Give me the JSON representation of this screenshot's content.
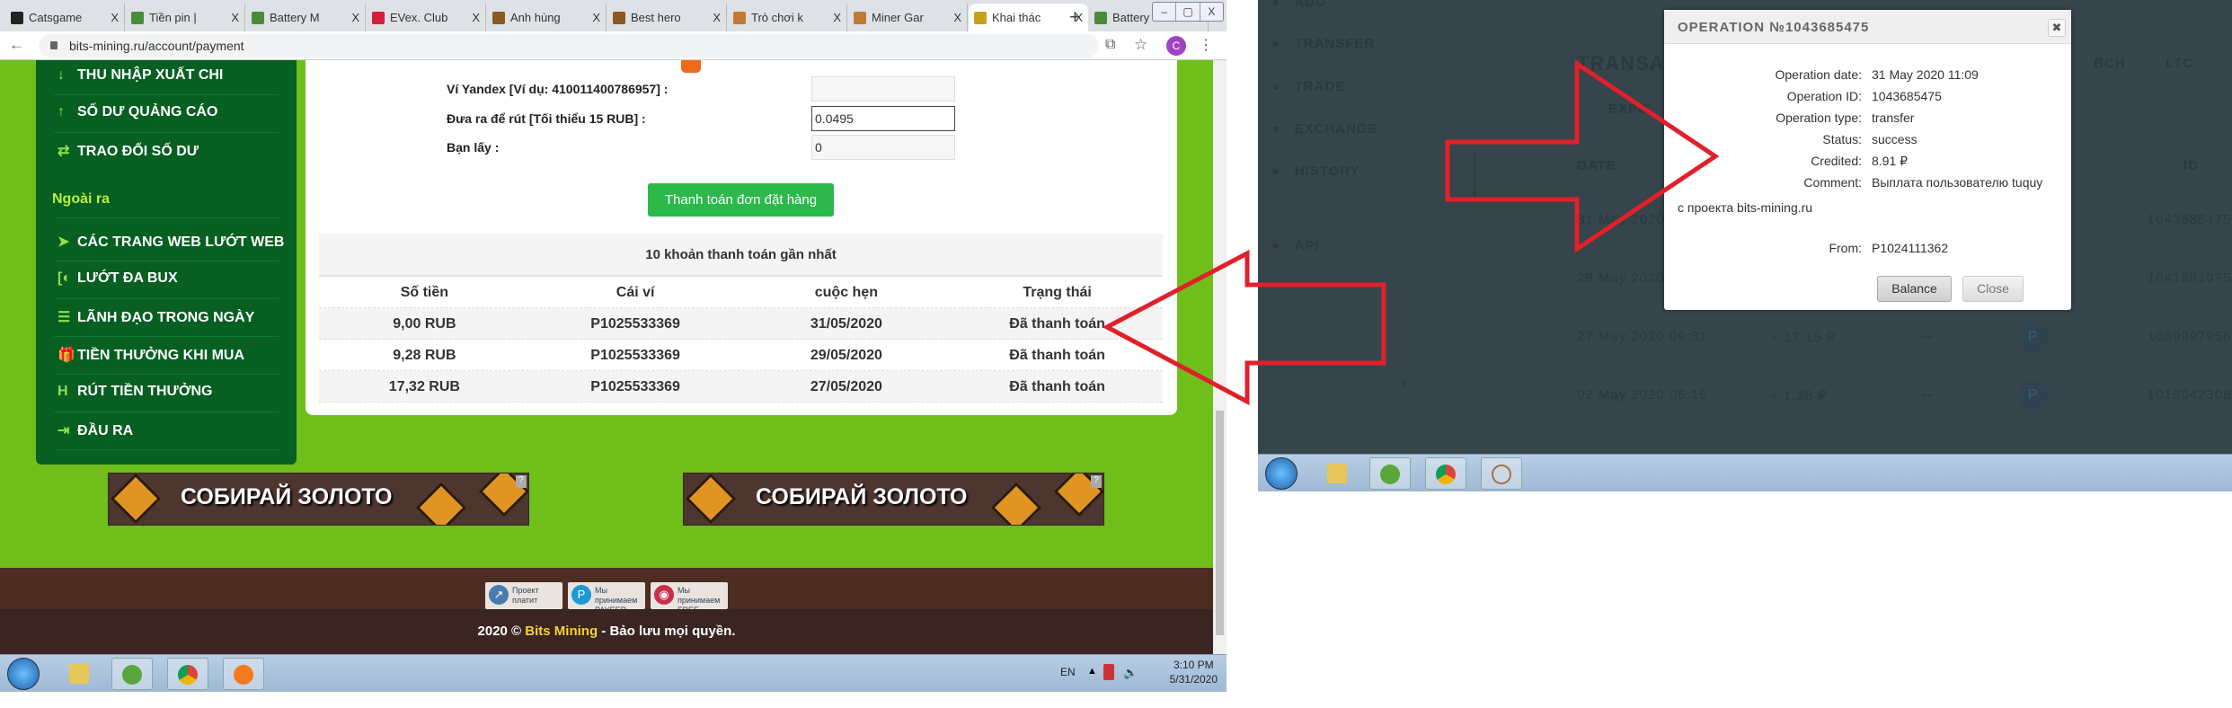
{
  "browser": {
    "tabs": [
      {
        "label": "Catsgame",
        "icon_color": "#222222"
      },
      {
        "label": "Tiền pin |",
        "icon_color": "#4a8c3a"
      },
      {
        "label": "Battery M",
        "icon_color": "#4a8c3a"
      },
      {
        "label": "EVex. Club",
        "icon_color": "#d0203a"
      },
      {
        "label": "Anh hùng",
        "icon_color": "#8a5a20"
      },
      {
        "label": "Best hero",
        "icon_color": "#8a5a20"
      },
      {
        "label": "Trò chơi k",
        "icon_color": "#c07a30"
      },
      {
        "label": "Miner Gar",
        "icon_color": "#c07a30"
      },
      {
        "label": "Khai thác",
        "icon_color": "#c8a020",
        "active": true
      },
      {
        "label": "Battery M",
        "icon_color": "#4a8c3a"
      }
    ],
    "tab_close": "X",
    "new_tab": "+",
    "window_controls": [
      "–",
      "▢",
      "X"
    ],
    "nav": [
      "←",
      "→",
      "C"
    ],
    "url": "bits-mining.ru/account/payment",
    "profile_initial": "C",
    "star": "☆"
  },
  "sidebar": {
    "items_top": [
      {
        "label": "THU NHẬP XUẤT CHI",
        "icon": "↓"
      },
      {
        "label": "SỐ DƯ QUẢNG CÁO",
        "icon": "↑"
      },
      {
        "label": "TRAO ĐỔI SỐ DƯ",
        "icon": "⇄"
      }
    ],
    "section": "Ngoài ra",
    "items_bottom": [
      {
        "label": "CÁC TRANG WEB LƯỚT WEB",
        "icon": "➤"
      },
      {
        "label": "LƯỚT ĐA BUX",
        "icon": "[◐"
      },
      {
        "label": "LÃNH ĐẠO TRONG NGÀY",
        "icon": "☰"
      },
      {
        "label": "TIỀN THƯỞNG KHI MUA",
        "icon": "🎁"
      },
      {
        "label": "RÚT TIỀN THƯỞNG",
        "icon": "H"
      },
      {
        "label": "ĐẦU RA",
        "icon": "⇥"
      }
    ]
  },
  "form": {
    "yandex_label": "Ví Yandex [Ví dụ: 410011400786957] :",
    "yandex_value": "",
    "withdraw_label": "Đưa ra để rút [Tối thiểu 15 RUB] :",
    "withdraw_value": "0.0495",
    "receive_label": "Bạn lấy :",
    "receive_value": "0",
    "submit": "Thanh toán đơn đặt hàng"
  },
  "payments": {
    "title": "10 khoản thanh toán gần nhất",
    "headers": [
      "Số tiền",
      "Cái ví",
      "cuộc hẹn",
      "Trạng thái"
    ],
    "rows": [
      [
        "9,00 RUB",
        "P1025533369",
        "31/05/2020",
        "Đã thanh toán"
      ],
      [
        "9,28 RUB",
        "P1025533369",
        "29/05/2020",
        "Đã thanh toán"
      ],
      [
        "17,32 RUB",
        "P1025533369",
        "27/05/2020",
        "Đã thanh toán"
      ]
    ]
  },
  "banners": [
    "СОБИРАЙ ЗОЛОТО",
    "СОБИРАЙ ЗОЛОТО"
  ],
  "footer": {
    "badges": [
      {
        "text": "Проект платит",
        "icon": "↗",
        "color": "#4a7bb0"
      },
      {
        "text": "Мы принимаем PAYEER",
        "icon": "P",
        "color": "#1a9ad6"
      },
      {
        "text": "Мы принимаем FREE-KASSA",
        "icon": "◉",
        "color": "#c8304a"
      }
    ],
    "copyright_prefix": "2020 ©",
    "brand": "Bits Mining",
    "copyright_suffix": "- Bảo lưu mọi quyền."
  },
  "taskbar_left": {
    "lang": "EN",
    "time": "3:10 PM",
    "date": "5/31/2020",
    "apps": [
      "explorer",
      "ccleaner",
      "chrome",
      "avast"
    ]
  },
  "payeer_backdrop": {
    "menu": [
      "ADD",
      "TRANSFER",
      "TRADE",
      "EXCHANGE",
      "HISTORY",
      "API"
    ],
    "section_title": "TRANSACT",
    "export": "EXPO",
    "currencies": [
      "BCH",
      "LTC"
    ],
    "col_date": "DATE",
    "col_id": "ID",
    "rows": [
      {
        "date": "31 May 2020 11:09",
        "amount": "",
        "id": "1043685475"
      },
      {
        "date": "29 May 2020 11:",
        "amount": "",
        "id": "1041881075"
      },
      {
        "date": "27 May 2020 09:31",
        "amount": "+ 17.15 ₽",
        "dash": "--",
        "id": "1039997956"
      },
      {
        "date": "02 May 2020 06:19",
        "amount": "+ 1.28 ₽",
        "dash": "--",
        "id": "1016042308"
      }
    ]
  },
  "dialog": {
    "title": "OPERATION №1043685475",
    "close_icon": "✖",
    "fields": [
      {
        "label": "Operation date:",
        "value": "31 May 2020 11:09"
      },
      {
        "label": "Operation ID:",
        "value": "1043685475"
      },
      {
        "label": "Operation type:",
        "value": "transfer"
      },
      {
        "label": "Status:",
        "value": "success"
      },
      {
        "label": "Credited:",
        "value": "8.91 ₽"
      },
      {
        "label": "Comment:",
        "value": "Выплата пользователю tuquy"
      }
    ],
    "comment_cont": "с проекта bits-mining.ru",
    "from_label": "From:",
    "from_value": "P1024111362",
    "balance_btn": "Balance",
    "close_btn": "Close"
  },
  "taskbar_right": {
    "apps": [
      "explorer",
      "ccleaner",
      "chrome",
      "paint"
    ]
  },
  "colors": {
    "page_green": "#6fbe1a",
    "sidebar_green": "#075f22",
    "button_green": "#2db84c",
    "arrow_red": "#e0202a",
    "payeer_bg": "#36444b"
  }
}
